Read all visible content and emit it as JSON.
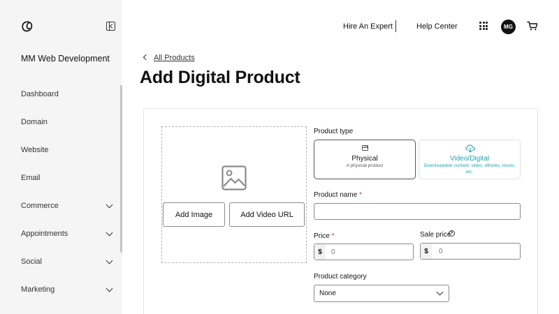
{
  "icons": {
    "logo": "godaddy-logo-icon",
    "collapse": "collapse-sidebar-icon",
    "apps": "apps-grid-icon",
    "cart": "cart-icon",
    "back": "chevron-left-icon",
    "image_placeholder": "image-icon",
    "physical": "box-icon",
    "digital": "cloud-download-icon",
    "help": "help-icon",
    "dropdown": "chevron-down-icon"
  },
  "colors": {
    "accent": "#1ba7b3",
    "sidebar_bg": "#f5f5f5",
    "required": "#c0392b",
    "avatar_bg": "#111111"
  },
  "sidebar": {
    "site_name": "MM Web Development",
    "items": [
      {
        "label": "Dashboard",
        "expandable": false
      },
      {
        "label": "Domain",
        "expandable": false
      },
      {
        "label": "Website",
        "expandable": false
      },
      {
        "label": "Email",
        "expandable": false
      },
      {
        "label": "Commerce",
        "expandable": true
      },
      {
        "label": "Appointments",
        "expandable": true
      },
      {
        "label": "Social",
        "expandable": true
      },
      {
        "label": "Marketing",
        "expandable": true
      }
    ]
  },
  "header": {
    "hire_expert": "Hire An Expert",
    "help_center": "Help Center",
    "avatar_initials": "MG"
  },
  "breadcrumb": {
    "back_label": "All Products"
  },
  "page": {
    "title": "Add Digital Product"
  },
  "media": {
    "add_image": "Add Image",
    "add_video_url": "Add Video URL"
  },
  "form": {
    "product_type_label": "Product type",
    "types": [
      {
        "title": "Physical",
        "subtitle": "A physical product",
        "selected": false
      },
      {
        "title": "Video/Digital",
        "subtitle": "Downloadable content, video, eBooks, music, etc.",
        "selected": true
      }
    ],
    "product_name_label": "Product name",
    "required_marker": "*",
    "product_name_value": "",
    "price_label": "Price",
    "price_currency": "$",
    "price_placeholder": "0",
    "sale_price_label": "Sale price",
    "help_glyph": "?",
    "sale_currency": "$",
    "sale_placeholder": "0",
    "category_label": "Product category",
    "category_value": "None"
  }
}
